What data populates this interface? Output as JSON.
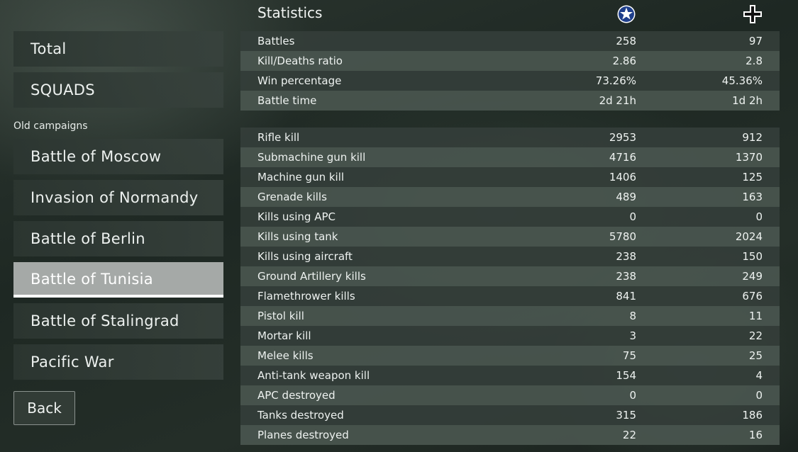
{
  "sidebar": {
    "items": [
      {
        "label": "Total"
      },
      {
        "label": "SQUADS"
      }
    ],
    "section_label": "Old campaigns",
    "campaigns": [
      {
        "label": "Battle of Moscow"
      },
      {
        "label": "Invasion of Normandy"
      },
      {
        "label": "Battle of Berlin"
      },
      {
        "label": "Battle of Tunisia",
        "active": true
      },
      {
        "label": "Battle of Stalingrad"
      },
      {
        "label": "Pacific War"
      }
    ],
    "back_label": "Back"
  },
  "stats": {
    "title": "Statistics",
    "factions": [
      "allied-star-icon",
      "axis-cross-icon"
    ],
    "general": [
      {
        "label": "Battles",
        "allies": "258",
        "axis": "97"
      },
      {
        "label": "Kill/Deaths ratio",
        "allies": "2.86",
        "axis": "2.8"
      },
      {
        "label": "Win percentage",
        "allies": "73.26%",
        "axis": "45.36%"
      },
      {
        "label": "Battle time",
        "allies": "2d 21h",
        "axis": "1d 2h"
      }
    ],
    "combat": [
      {
        "label": "Rifle kill",
        "allies": "2953",
        "axis": "912"
      },
      {
        "label": "Submachine gun kill",
        "allies": "4716",
        "axis": "1370"
      },
      {
        "label": "Machine gun kill",
        "allies": "1406",
        "axis": "125"
      },
      {
        "label": "Grenade kills",
        "allies": "489",
        "axis": "163"
      },
      {
        "label": "Kills using APC",
        "allies": "0",
        "axis": "0"
      },
      {
        "label": "Kills using tank",
        "allies": "5780",
        "axis": "2024"
      },
      {
        "label": "Kills using aircraft",
        "allies": "238",
        "axis": "150"
      },
      {
        "label": "Ground Artillery kills",
        "allies": "238",
        "axis": "249"
      },
      {
        "label": "Flamethrower kills",
        "allies": "841",
        "axis": "676"
      },
      {
        "label": "Pistol kill",
        "allies": "8",
        "axis": "11"
      },
      {
        "label": "Mortar kill",
        "allies": "3",
        "axis": "22"
      },
      {
        "label": "Melee kills",
        "allies": "75",
        "axis": "25"
      },
      {
        "label": "Anti-tank weapon kill",
        "allies": "154",
        "axis": "4"
      },
      {
        "label": "APC destroyed",
        "allies": "0",
        "axis": "0"
      },
      {
        "label": "Tanks destroyed",
        "allies": "315",
        "axis": "186"
      },
      {
        "label": "Planes destroyed",
        "allies": "22",
        "axis": "16"
      }
    ]
  }
}
